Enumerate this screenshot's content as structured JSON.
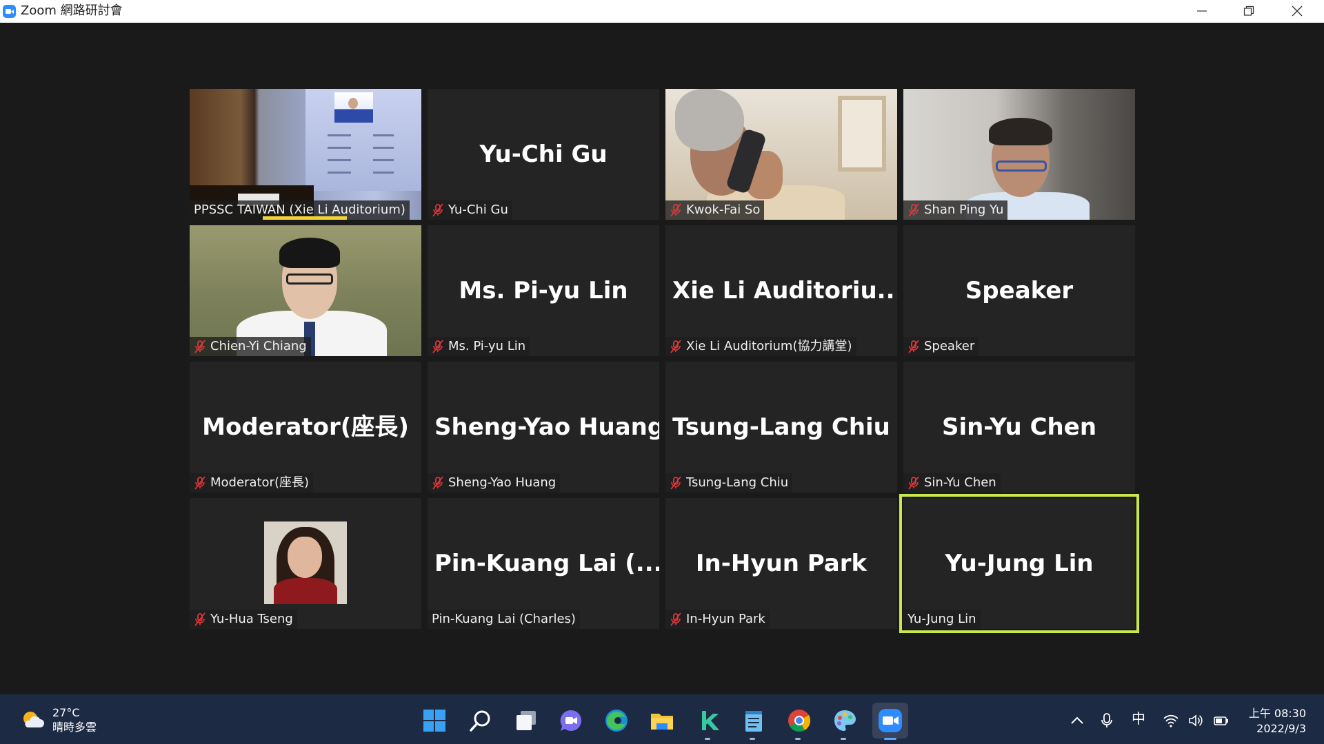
{
  "window": {
    "title": "Zoom 網路研討會"
  },
  "gallery": {
    "tiles": [
      {
        "display": "",
        "label": "PPSSC TAIWAN (Xie Li Auditorium)",
        "muted": false,
        "video": "auditorium",
        "speaking": true
      },
      {
        "display": "Yu-Chi Gu",
        "label": "Yu-Chi Gu",
        "muted": true
      },
      {
        "display": "",
        "label": "Kwok-Fai So",
        "muted": true,
        "video": "kwok"
      },
      {
        "display": "",
        "label": "Shan Ping Yu",
        "muted": true,
        "video": "shan"
      },
      {
        "display": "",
        "label": "Chien-Yi Chiang",
        "muted": true,
        "video": "chien"
      },
      {
        "display": "Ms. Pi-yu Lin",
        "label": "Ms. Pi-yu Lin",
        "muted": true
      },
      {
        "display": "Xie Li Auditoriu...",
        "label": "Xie Li Auditorium(協力講堂)",
        "muted": true
      },
      {
        "display": "Speaker",
        "label": "Speaker",
        "muted": true
      },
      {
        "display": "Moderator(座長)",
        "label": "Moderator(座長)",
        "muted": true
      },
      {
        "display": "Sheng-Yao Huang",
        "label": "Sheng-Yao Huang",
        "muted": true
      },
      {
        "display": "Tsung-Lang Chiu",
        "label": "Tsung-Lang Chiu",
        "muted": true
      },
      {
        "display": "Sin-Yu Chen",
        "label": "Sin-Yu Chen",
        "muted": true
      },
      {
        "display": "",
        "label": "Yu-Hua Tseng",
        "muted": true,
        "video": "photo"
      },
      {
        "display": "Pin-Kuang Lai (...",
        "label": "Pin-Kuang Lai (Charles)",
        "muted": false
      },
      {
        "display": "In-Hyun Park",
        "label": "In-Hyun Park",
        "muted": true
      },
      {
        "display": "Yu-Jung Lin",
        "label": "Yu-Jung Lin",
        "muted": false,
        "active": true
      }
    ]
  },
  "taskbar": {
    "weather": {
      "temp": "27°C",
      "desc": "晴時多雲"
    },
    "apps": [
      "start-icon",
      "search-icon",
      "task-view-icon",
      "chat-icon",
      "edge-icon",
      "file-explorer-icon",
      "kuaiya-k-icon",
      "notepad-icon",
      "chrome-icon",
      "paint-icon",
      "zoom-icon"
    ],
    "tray": {
      "ime": "中"
    },
    "clock": {
      "time": "上午 08:30",
      "date": "2022/9/3"
    }
  },
  "colors": {
    "active_speaker_border": "#c9e94a",
    "speaking_indicator": "#f1d434",
    "muted_icon": "#e0363a",
    "taskbar_bg": "#1d2a44",
    "tile_bg": "#242424"
  }
}
